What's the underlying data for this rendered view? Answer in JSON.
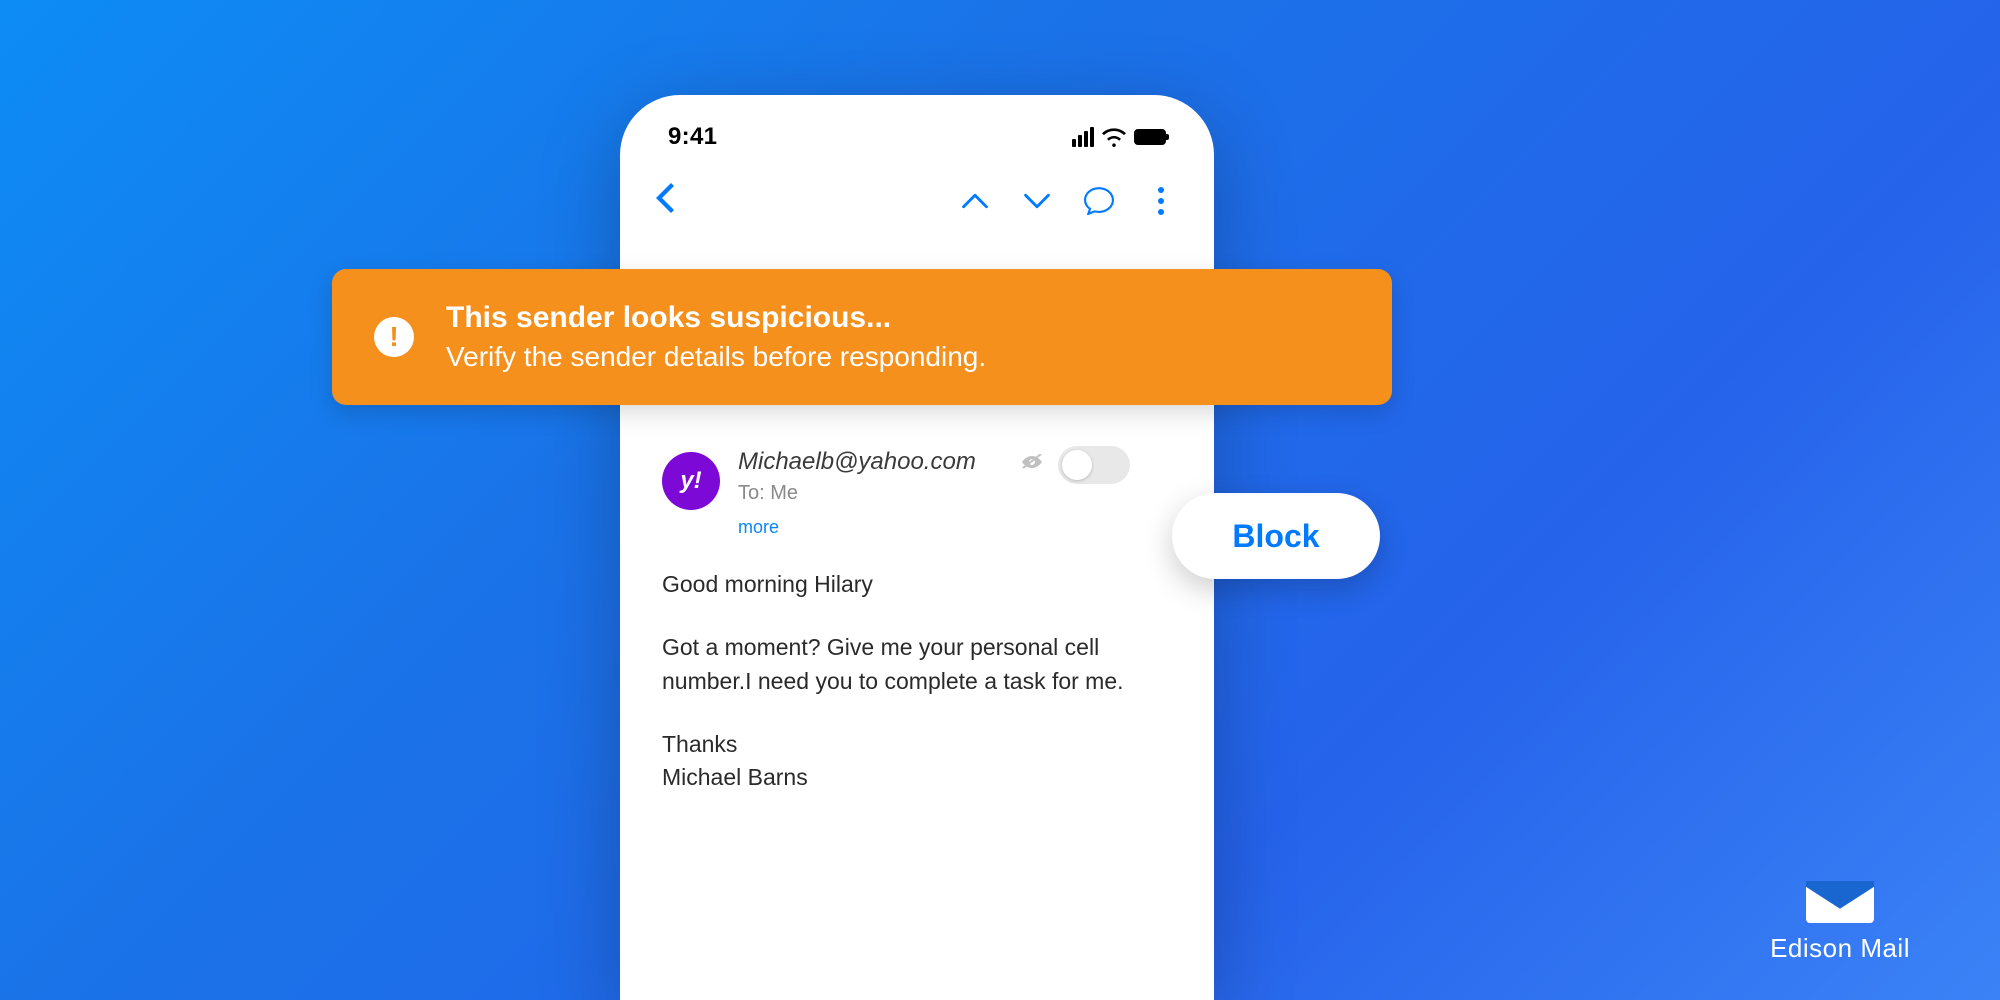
{
  "statusbar": {
    "time": "9:41"
  },
  "warning": {
    "title": "This sender looks suspicious...",
    "subtitle": "Verify the sender details before responding."
  },
  "email": {
    "avatar_label": "y!",
    "sender": "Michaelb@yahoo.com",
    "to_line": "To: Me",
    "more_label": "more",
    "body_line1": "Good morning Hilary",
    "body_line2": "Got a moment? Give me your personal cell number.I need you to complete a task for me.",
    "body_line3": "Thanks",
    "body_line4": "Michael Barns"
  },
  "actions": {
    "block_label": "Block"
  },
  "brand": {
    "name": "Edison Mail"
  }
}
